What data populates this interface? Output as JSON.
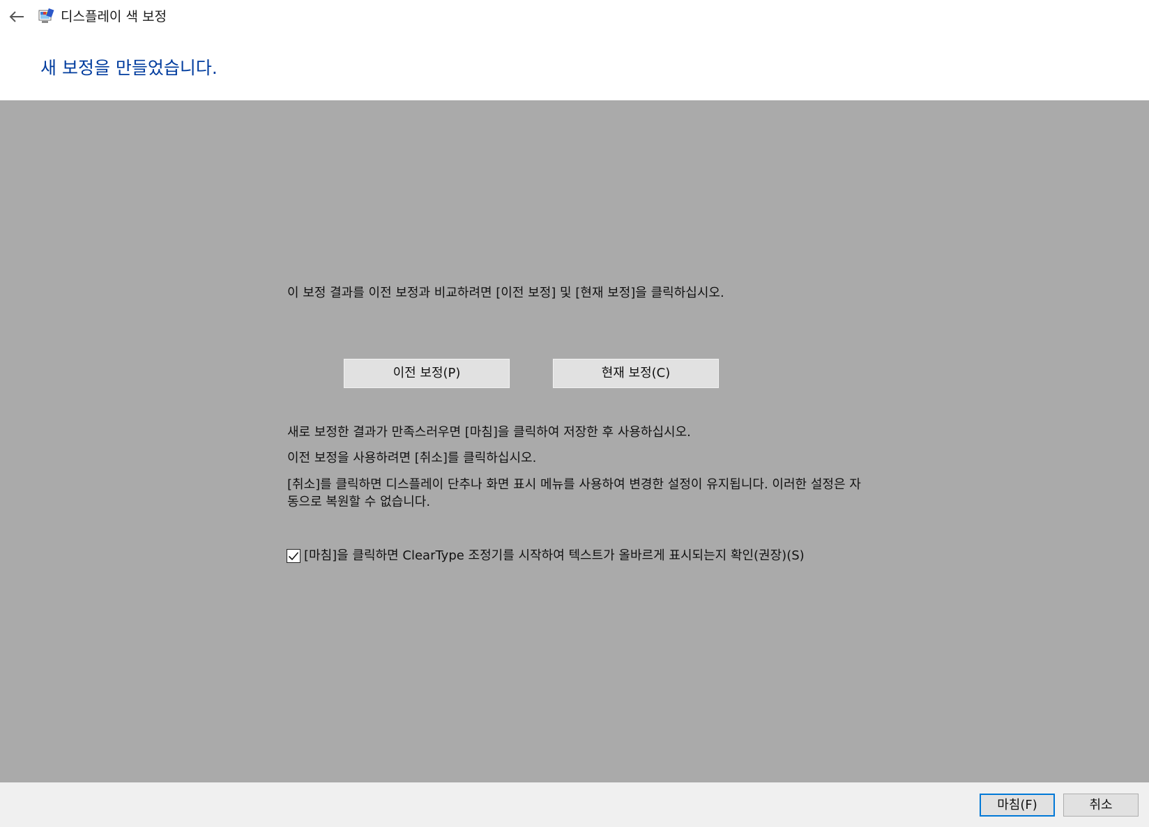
{
  "window": {
    "title": "디스플레이 색 보정",
    "back_icon": "arrow-left-icon",
    "app_icon": "display-color-calibration-icon"
  },
  "heading": "새 보정을 만들었습니다.",
  "compare": {
    "instruction": "이 보정 결과를 이전 보정과 비교하려면 [이전 보정] 및 [현재 보정]을 클릭하십시오.",
    "previous_button": "이전 보정(P)",
    "current_button": "현재 보정(C)"
  },
  "info": {
    "satisfied": "새로 보정한 결과가 만족스러우면 [마침]을 클릭하여 저장한 후 사용하십시오.",
    "use_previous": "이전 보정을 사용하려면 [취소]를 클릭하십시오.",
    "cancel_note": "[취소]를 클릭하면 디스플레이 단추나 화면 표시 메뉴를 사용하여 변경한 설정이 유지됩니다. 이러한 설정은 자동으로 복원할 수 없습니다."
  },
  "cleartype": {
    "checked": true,
    "label": "[마침]을 클릭하면 ClearType 조정기를 시작하여 텍스트가 올바르게 표시되는지 확인(권장)(S)"
  },
  "footer": {
    "finish_button": "마침(F)",
    "cancel_button": "취소"
  },
  "colors": {
    "heading": "#003c9e",
    "content_background": "#aaaaaa",
    "footer_background": "#f0f0f0",
    "default_button_border": "#0078d7"
  }
}
